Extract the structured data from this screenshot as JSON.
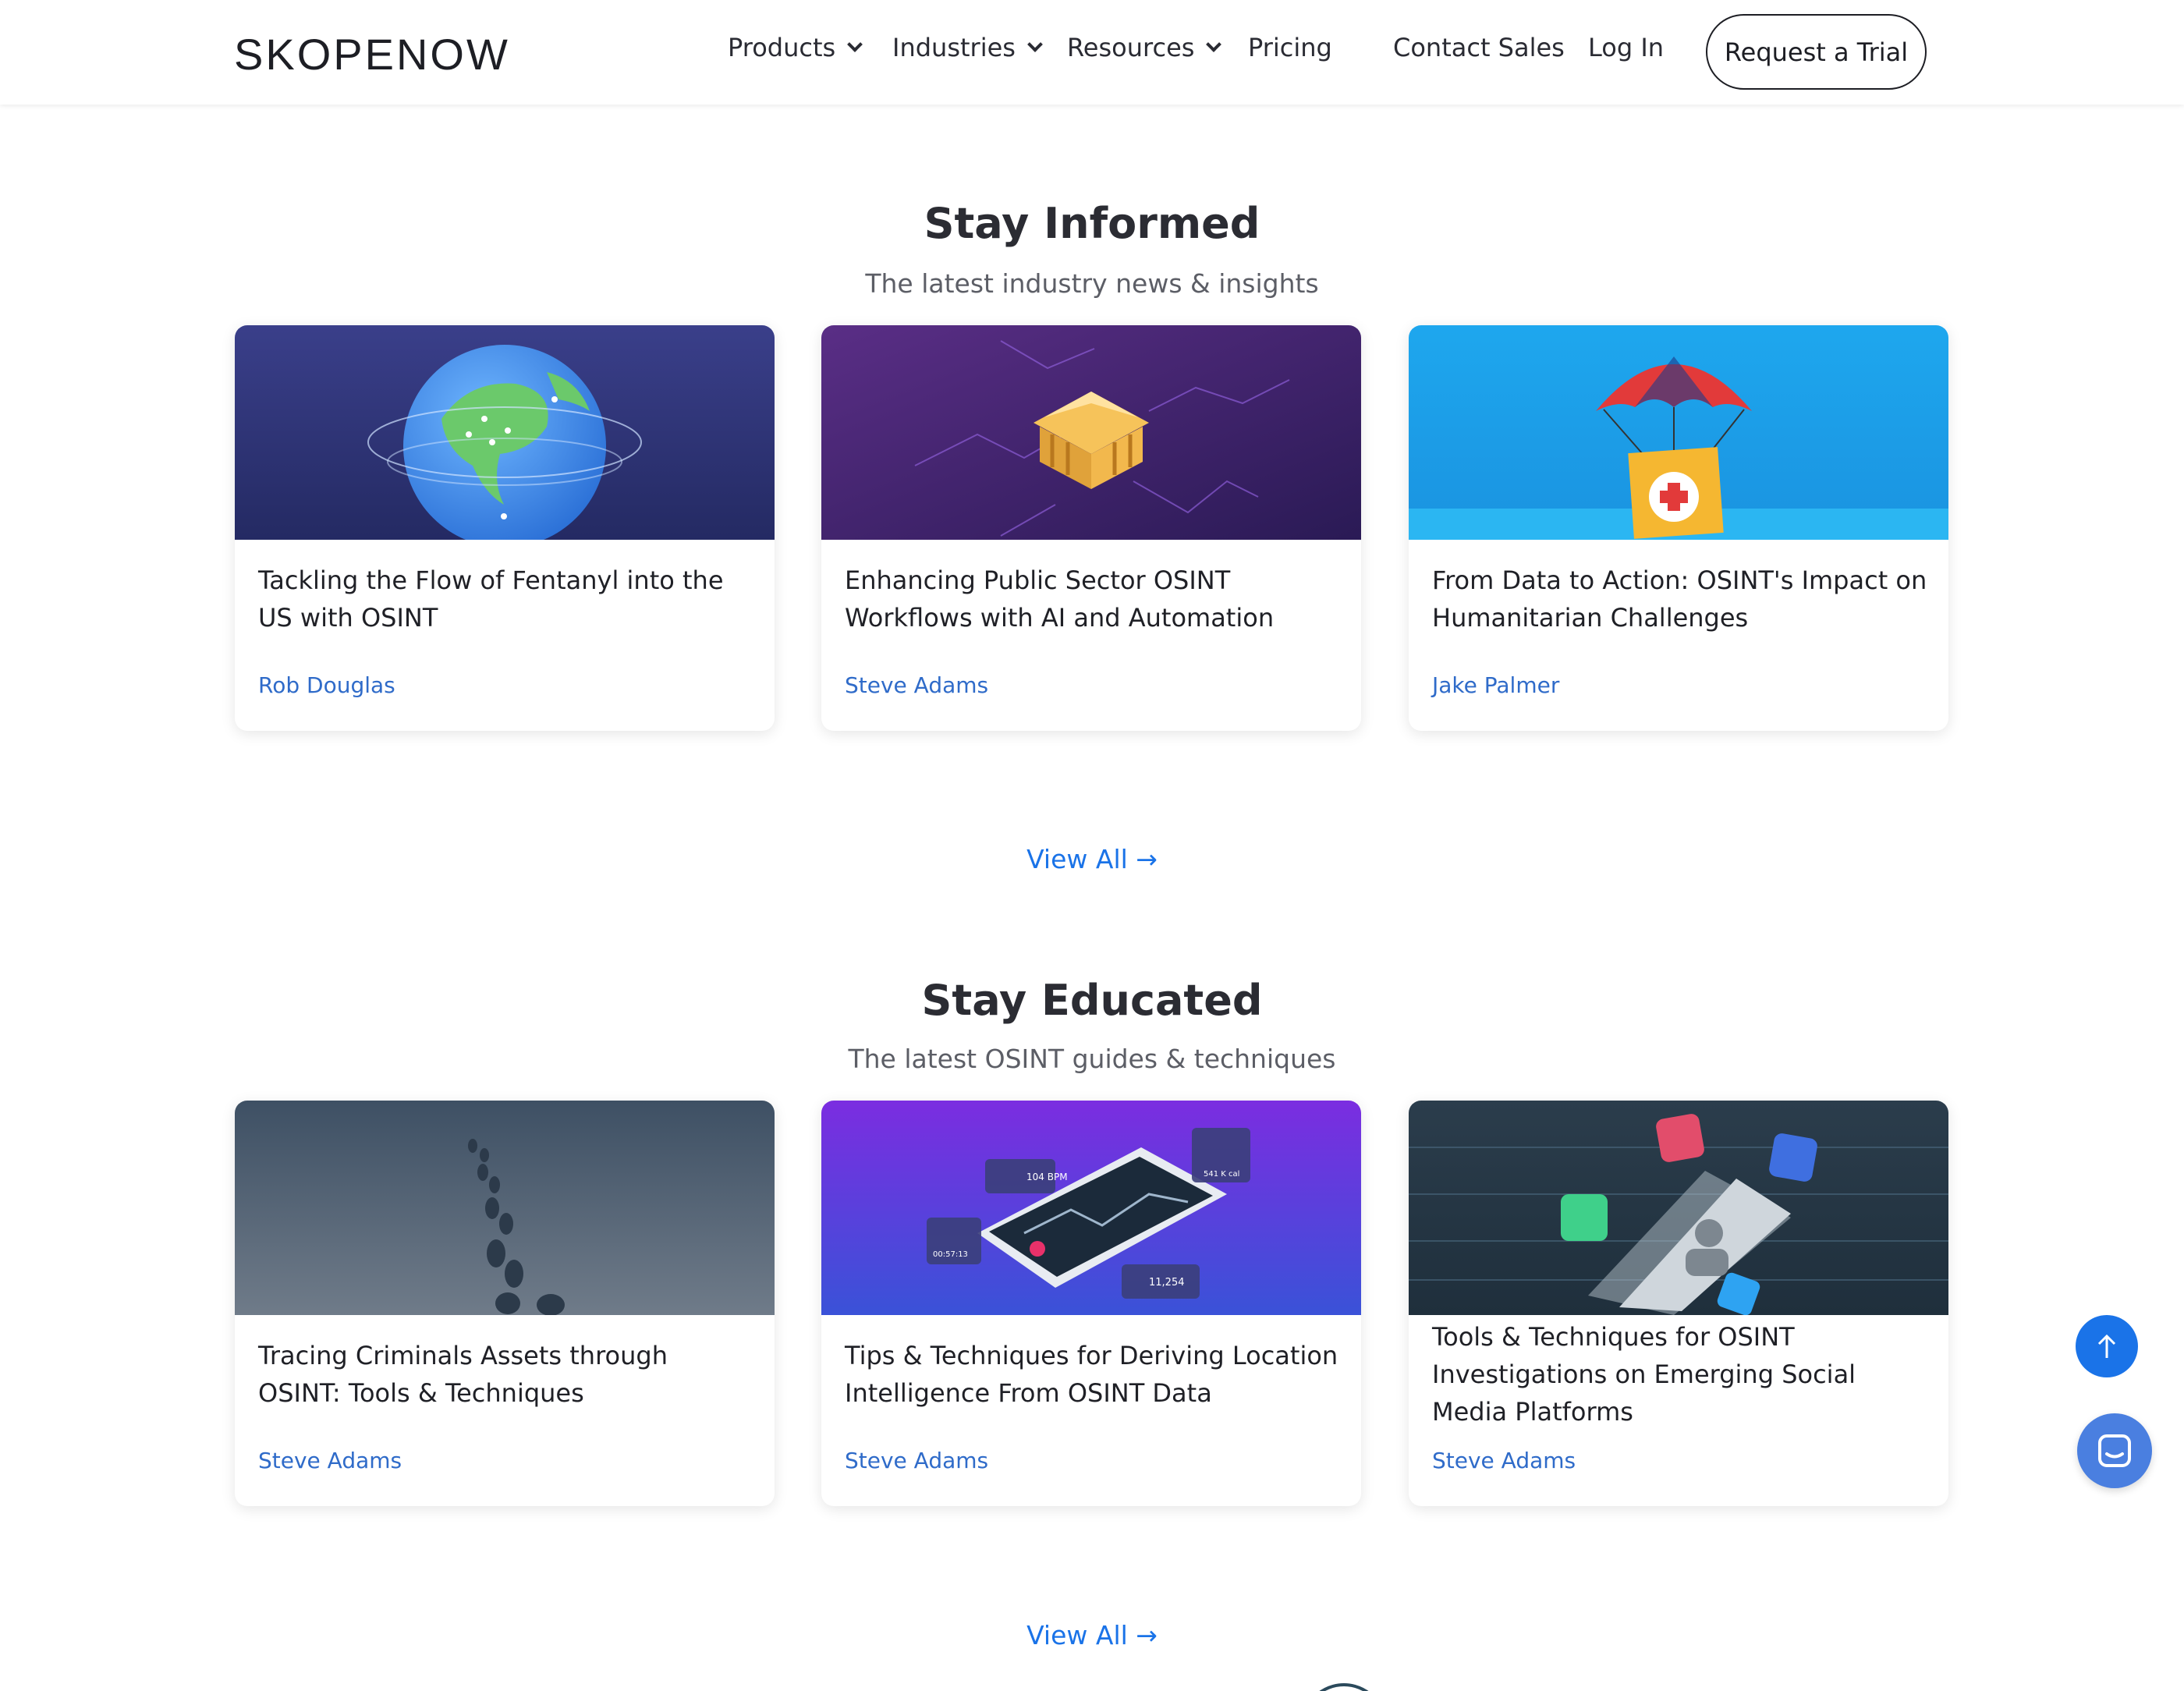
{
  "header": {
    "logo": "SKOPENOW",
    "nav": {
      "products": "Products",
      "industries": "Industries",
      "resources": "Resources",
      "pricing": "Pricing",
      "contact_sales": "Contact Sales",
      "log_in": "Log In"
    },
    "trial_button": "Request a Trial"
  },
  "informed": {
    "title": "Stay Informed",
    "subtitle": "The latest industry news & insights",
    "cards": [
      {
        "title": "Tackling the Flow of Fentanyl into the US with OSINT",
        "author": "Rob Douglas",
        "image_icon": "globe-illustration"
      },
      {
        "title": "Enhancing Public Sector OSINT Workflows with AI and Automation",
        "author": "Steve Adams",
        "image_icon": "government-building-illustration"
      },
      {
        "title": "From Data to Action: OSINT's Impact on Humanitarian Challenges",
        "author": "Jake Palmer",
        "image_icon": "aid-parachute-illustration"
      }
    ],
    "view_all": "View All"
  },
  "educated": {
    "title": "Stay Educated",
    "subtitle": "The latest OSINT guides & techniques",
    "cards": [
      {
        "title": "Tracing Criminals Assets through OSINT: Tools & Techniques",
        "author": "Steve Adams",
        "image_icon": "footprints-illustration"
      },
      {
        "title": "Tips & Techniques for Deriving Location Intelligence From OSINT Data",
        "author": "Steve Adams",
        "image_icon": "phone-map-illustration",
        "image_text": {
          "bpm": "104 BPM",
          "kcal": "541 K cal",
          "timer": "00:57:13",
          "steps": "11,254"
        }
      },
      {
        "title": "Tools & Techniques for OSINT Investigations on Emerging Social Media Platforms",
        "author": "Steve Adams",
        "image_icon": "social-phone-illustration"
      }
    ],
    "view_all": "View All"
  },
  "colors": {
    "accent": "#1a73e8",
    "author": "#2f6bc9",
    "chat": "#4a7fe0"
  },
  "widgets": {
    "scroll_top_icon": "arrow-up-icon",
    "chat_icon": "chat-icon",
    "view_all_icon": "arrow-right-icon"
  }
}
